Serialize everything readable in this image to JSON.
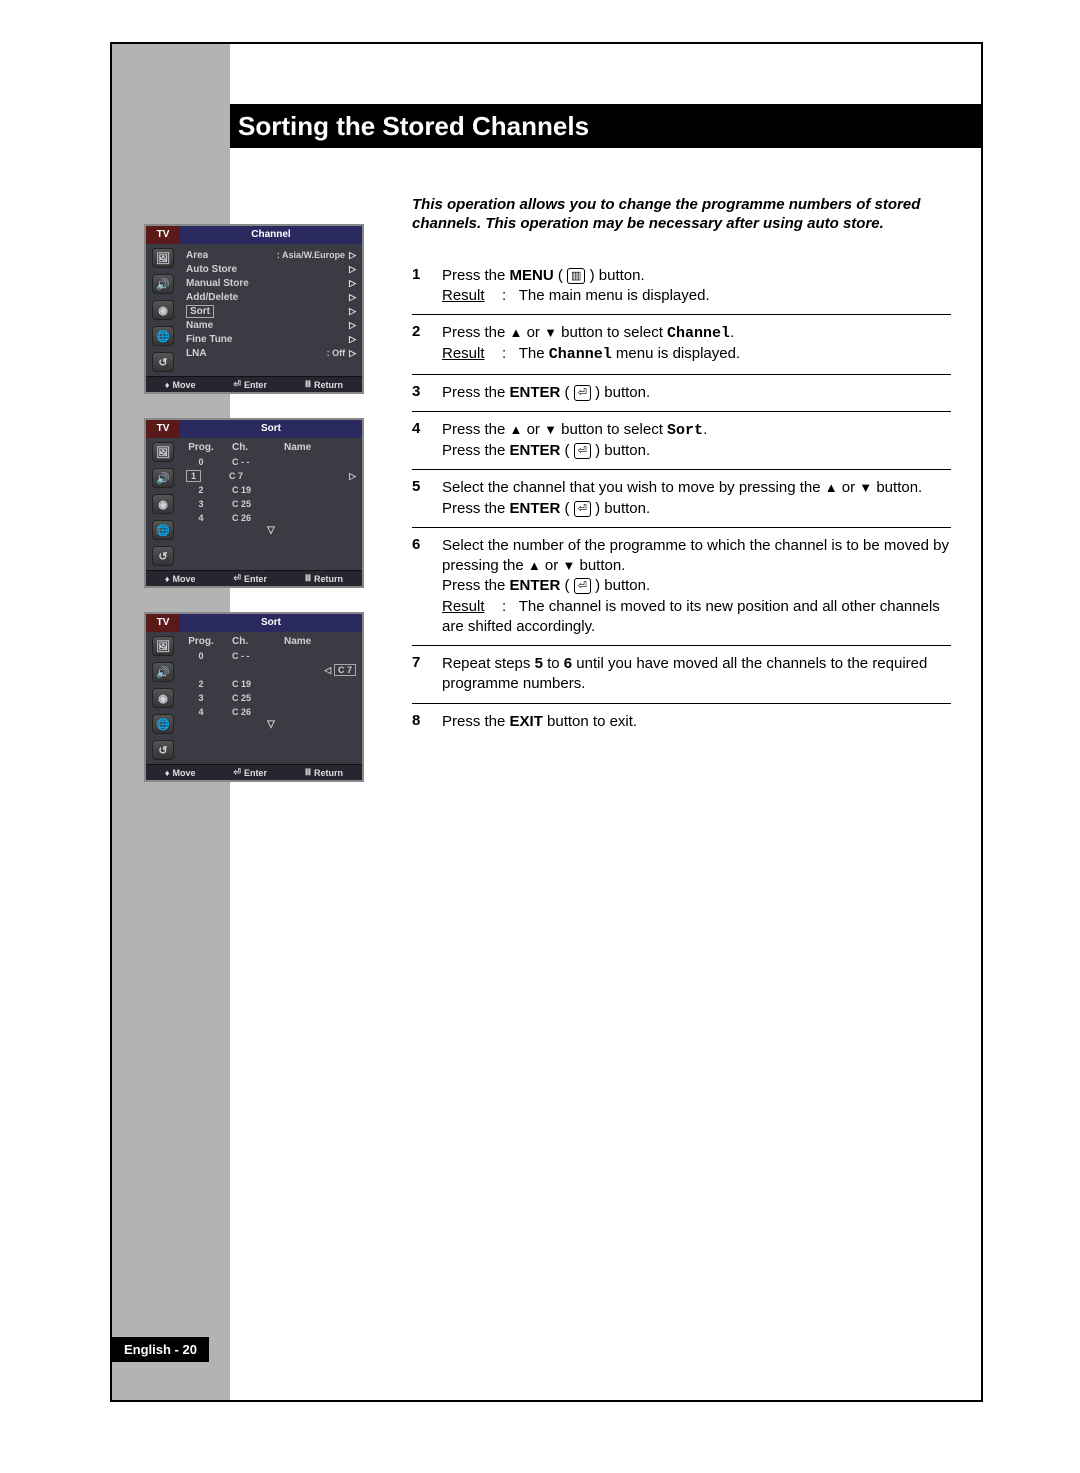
{
  "title": "Sorting the Stored Channels",
  "footer": "English - 20",
  "intro": "This operation allows you to change the programme numbers of stored channels. This operation may be necessary after using auto store.",
  "osd1": {
    "tv": "TV",
    "header": "Channel",
    "items": [
      {
        "label": "Area",
        "value": ": Asia/W.Europe"
      },
      {
        "label": "Auto Store",
        "value": ""
      },
      {
        "label": "Manual Store",
        "value": ""
      },
      {
        "label": "Add/Delete",
        "value": ""
      },
      {
        "label": "Sort",
        "value": "",
        "selected": true
      },
      {
        "label": "Name",
        "value": ""
      },
      {
        "label": "Fine Tune",
        "value": ""
      },
      {
        "label": "LNA",
        "value": ": Off"
      }
    ],
    "footer": {
      "move": "Move",
      "enter": "Enter",
      "ret": "Return"
    }
  },
  "osd2": {
    "tv": "TV",
    "header": "Sort",
    "cols": {
      "prog": "Prog.",
      "ch": "Ch.",
      "name": "Name"
    },
    "rows": [
      {
        "p": "0",
        "c": "C - -"
      },
      {
        "p": "1",
        "c": "C 7",
        "selected": true
      },
      {
        "p": "2",
        "c": "C 19"
      },
      {
        "p": "3",
        "c": "C 25"
      },
      {
        "p": "4",
        "c": "C 26"
      }
    ],
    "footer": {
      "move": "Move",
      "enter": "Enter",
      "ret": "Return"
    }
  },
  "osd3": {
    "tv": "TV",
    "header": "Sort",
    "cols": {
      "prog": "Prog.",
      "ch": "Ch.",
      "name": "Name"
    },
    "rows": [
      {
        "p": "0",
        "c": "C - -"
      },
      {
        "p": "",
        "c": "",
        "move": "C 7"
      },
      {
        "p": "2",
        "c": "C 19"
      },
      {
        "p": "3",
        "c": "C 25"
      },
      {
        "p": "4",
        "c": "C 26"
      }
    ],
    "footer": {
      "move": "Move",
      "enter": "Enter",
      "ret": "Return"
    }
  },
  "steps": {
    "s1": {
      "num": "1",
      "t1": "Press the ",
      "b1": "MENU",
      "t2": " ( ",
      "t3": " ) button.",
      "rlab": "Result",
      "rsep": ":",
      "rtext": "The main menu is displayed."
    },
    "s2": {
      "num": "2",
      "t1": "Press the ",
      "t2": " or ",
      "t3": " button to select ",
      "b1": "Channel",
      "t4": ".",
      "rlab": "Result",
      "rsep": ":",
      "rtext1": "The ",
      "rmono": "Channel",
      "rtext2": " menu is displayed."
    },
    "s3": {
      "num": "3",
      "t1": "Press the ",
      "b1": "ENTER",
      "t2": " ( ",
      "t3": " ) button."
    },
    "s4": {
      "num": "4",
      "t1": "Press the ",
      "t2": " or ",
      "t3": " button to select ",
      "b1": "Sort",
      "t4": ".",
      "l2a": "Press the ",
      "l2b": "ENTER",
      "l2c": " ( ",
      "l2d": " ) button."
    },
    "s5": {
      "num": "5",
      "t1": "Select the channel that you wish to move by pressing the ",
      "t2": " or ",
      "t3": " button. Press the ",
      "b1": "ENTER",
      "t4": " ( ",
      "t5": " ) button."
    },
    "s6": {
      "num": "6",
      "t1": "Select the number of the programme to which the channel is to be moved by pressing the ",
      "t2": " or ",
      "t3": " button.",
      "l2a": "Press the ",
      "l2b": "ENTER",
      "l2c": " ( ",
      "l2d": " ) button.",
      "rlab": "Result",
      "rsep": ":",
      "rtext": "The channel is moved to its new position and all other channels are shifted accordingly."
    },
    "s7": {
      "num": "7",
      "t1": "Repeat steps ",
      "b1": "5",
      "t2": " to ",
      "b2": "6",
      "t3": " until you have moved all the channels to the required programme numbers."
    },
    "s8": {
      "num": "8",
      "t1": "Press the ",
      "b1": "EXIT",
      "t2": " button to exit."
    }
  }
}
